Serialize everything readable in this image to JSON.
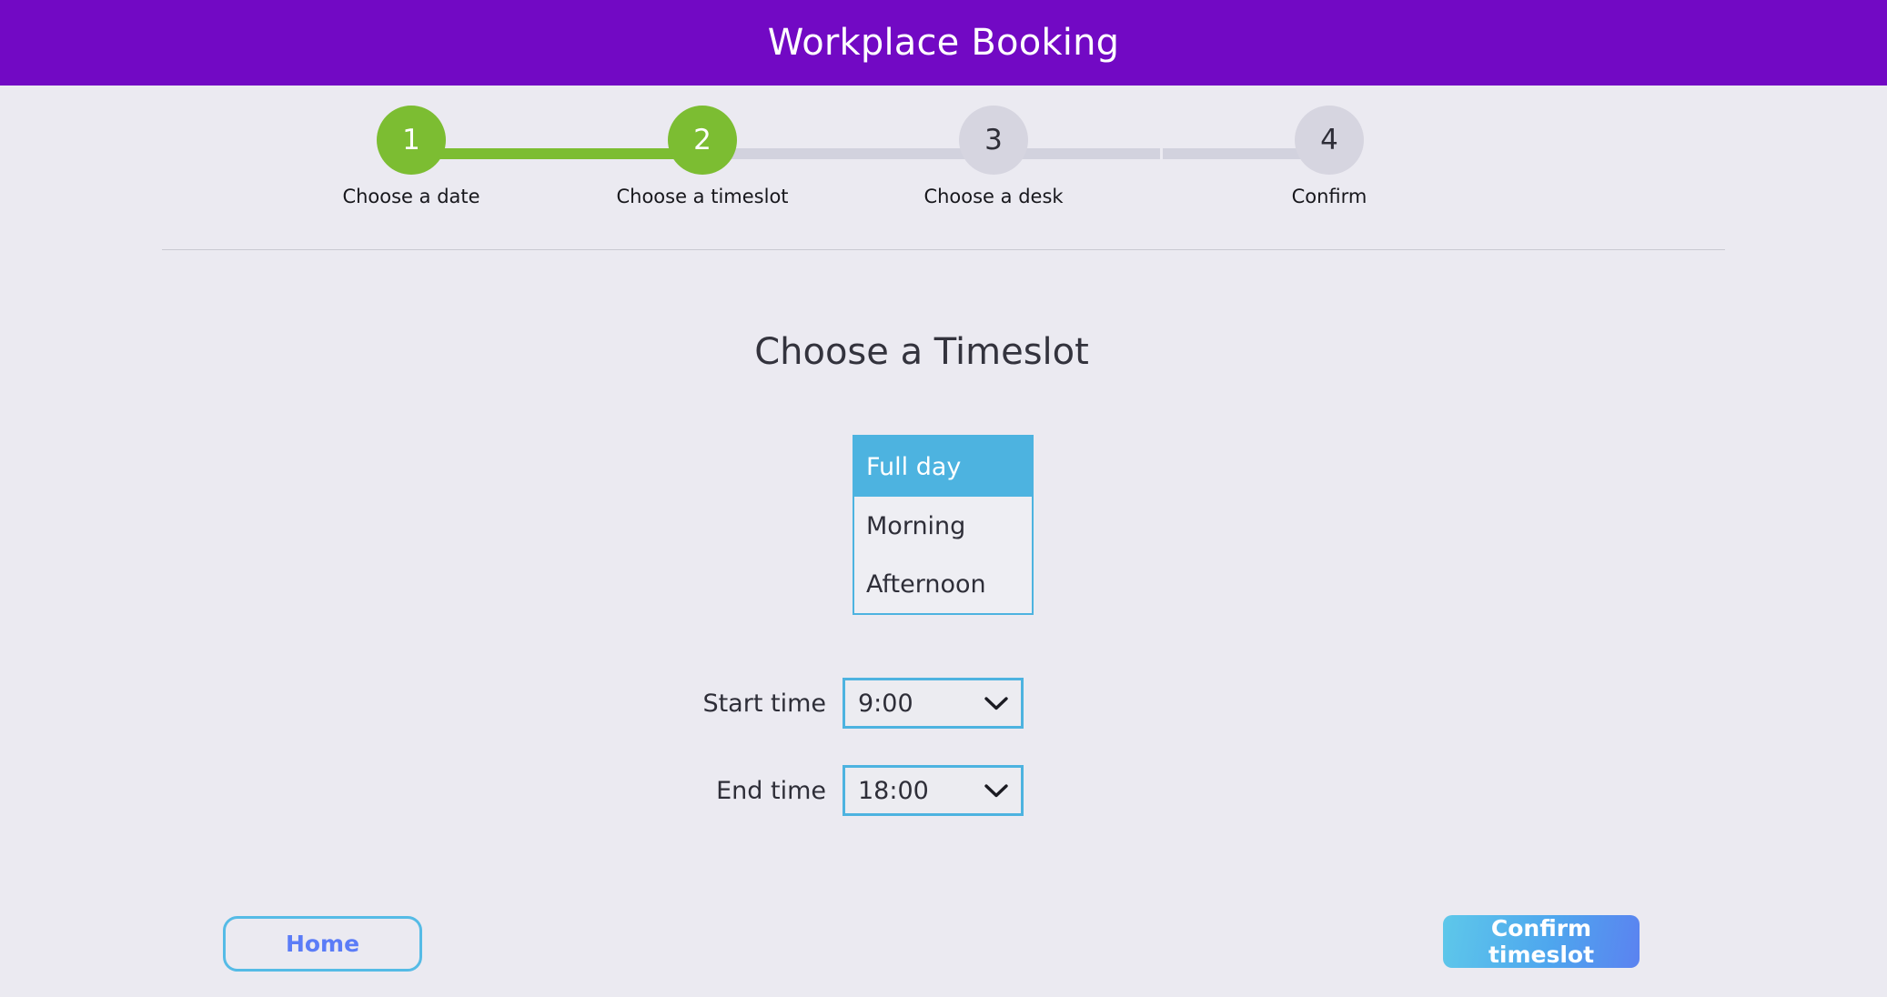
{
  "header": {
    "title": "Workplace Booking",
    "background_color": "#7209c4",
    "text_color": "#ffffff"
  },
  "stepper": {
    "current_step": 2,
    "completed_color": "#7cbd32",
    "pending_color": "#d6d5e0",
    "steps": [
      {
        "number": "1",
        "label": "Choose a date",
        "state": "done"
      },
      {
        "number": "2",
        "label": "Choose a timeslot",
        "state": "done"
      },
      {
        "number": "3",
        "label": "Choose a desk",
        "state": "pending"
      },
      {
        "number": "4",
        "label": "Confirm",
        "state": "pending"
      }
    ]
  },
  "main": {
    "page_title": "Choose a Timeslot",
    "timeslot_listbox": {
      "selected": "Full day",
      "accent_color": "#4db3e0",
      "options": [
        {
          "label": "Full day",
          "selected": true
        },
        {
          "label": "Morning",
          "selected": false
        },
        {
          "label": "Afternoon",
          "selected": false
        }
      ]
    },
    "start_time": {
      "label": "Start time",
      "value": "9:00",
      "icon": "chevron-down-icon"
    },
    "end_time": {
      "label": "End time",
      "value": "18:00",
      "icon": "chevron-down-icon"
    }
  },
  "footer": {
    "home_label": "Home",
    "home_text_color": "#5b7cf7",
    "confirm_label": "Confirm timeslot",
    "confirm_gradient_from": "#5ec8ea",
    "confirm_gradient_to": "#5b82f0"
  }
}
